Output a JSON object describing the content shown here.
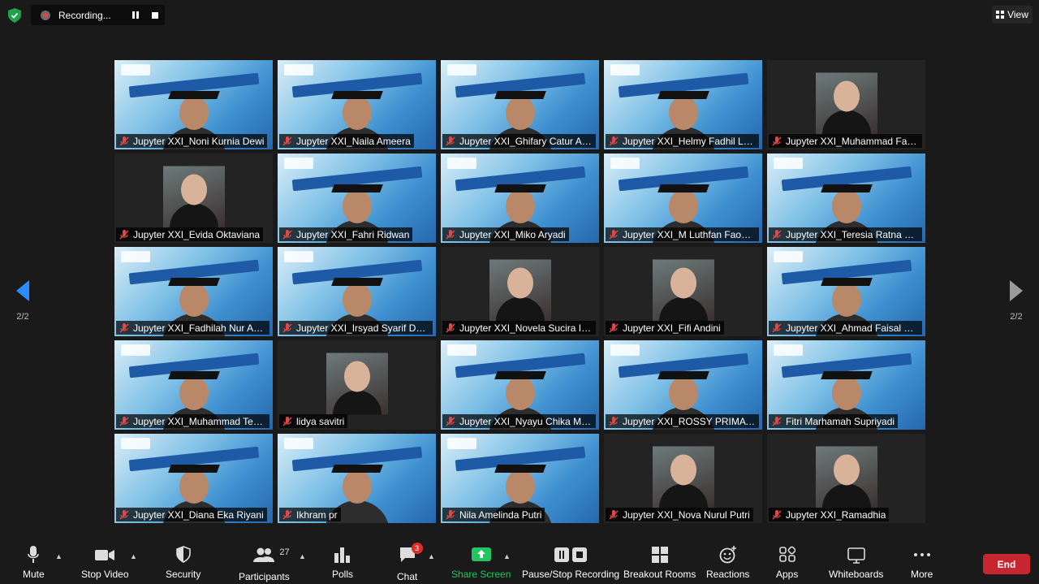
{
  "recording": {
    "label": "Recording..."
  },
  "view_label": "View",
  "pagination": {
    "left": "2/2",
    "right": "2/2"
  },
  "participants": [
    {
      "name": "Jupyter XXI_Noni Kurnia Dewi",
      "kind": "video"
    },
    {
      "name": "Jupyter XXI_Naila Ameera",
      "kind": "video"
    },
    {
      "name": "Jupyter XXI_Ghifary Catur Ach...",
      "kind": "video"
    },
    {
      "name": "Jupyter XXI_Helmy Fadhil Lan...",
      "kind": "video"
    },
    {
      "name": "Jupyter XXI_Muhammad Fath...",
      "kind": "photo"
    },
    {
      "name": "Jupyter XXI_Evida Oktaviana",
      "kind": "photo"
    },
    {
      "name": "Jupyter XXI_Fahri Ridwan",
      "kind": "video"
    },
    {
      "name": "Jupyter XXI_Miko Aryadi",
      "kind": "video"
    },
    {
      "name": "Jupyter XXI_M Luthfan Faohan",
      "kind": "video"
    },
    {
      "name": "Jupyter XXI_Teresia Ratna Cali...",
      "kind": "video"
    },
    {
      "name": "Jupyter XXI_Fadhilah Nur Ama...",
      "kind": "video"
    },
    {
      "name": "Jupyter XXI_Irsyad Syarif Dwi ...",
      "kind": "video"
    },
    {
      "name": "Jupyter XXI_Novela Sucira I. S",
      "kind": "photo"
    },
    {
      "name": "Jupyter XXI_Fifi Andini",
      "kind": "photo"
    },
    {
      "name": "Jupyter XXI_Ahmad Faisal Sire...",
      "kind": "video"
    },
    {
      "name": "Jupyter XXI_Muhammad Tega...",
      "kind": "video"
    },
    {
      "name": "lidya savitri",
      "kind": "photo"
    },
    {
      "name": "Jupyter XXI_Nyayu Chika Mar...",
      "kind": "video"
    },
    {
      "name": "Jupyter XXI_ROSSY PRIMA NA...",
      "kind": "video"
    },
    {
      "name": "Fitri Marhamah Supriyadi",
      "kind": "video"
    },
    {
      "name": "Jupyter XXI_Diana Eka Riyani",
      "kind": "video"
    },
    {
      "name": "Ikhram pr",
      "kind": "video"
    },
    {
      "name": "Nila Amelinda Putri",
      "kind": "video"
    },
    {
      "name": "Jupyter XXI_Nova Nurul Putri",
      "kind": "photo"
    },
    {
      "name": "Jupyter XXI_Ramadhia",
      "kind": "photo"
    }
  ],
  "toolbar": {
    "mute": "Mute",
    "stop_video": "Stop Video",
    "security": "Security",
    "participants": "Participants",
    "participants_count": "27",
    "polls": "Polls",
    "chat": "Chat",
    "chat_badge": "3",
    "share_screen": "Share Screen",
    "pause_stop_recording": "Pause/Stop Recording",
    "breakout_rooms": "Breakout Rooms",
    "reactions": "Reactions",
    "apps": "Apps",
    "whiteboards": "Whiteboards",
    "more": "More",
    "end": "End"
  },
  "colors": {
    "accent_green": "#22c55e",
    "end_red": "#c7252f"
  }
}
